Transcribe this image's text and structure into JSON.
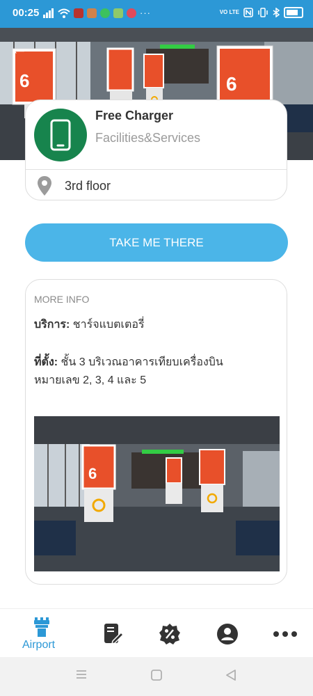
{
  "status_bar": {
    "time": "00:25",
    "left_icons": [
      "signal-icon",
      "wifi-icon",
      "app-icon",
      "app-icon",
      "whatsapp-icon",
      "app-icon",
      "app-icon"
    ],
    "more": "···",
    "right": {
      "volte": "VO LTE",
      "icons": [
        "nfc-icon",
        "vibrate-icon",
        "bluetooth-icon",
        "battery-icon"
      ]
    }
  },
  "hero": {
    "back_icon": "back-arrow-icon"
  },
  "facility": {
    "title": "Free Charger",
    "category": "Facilities&Services",
    "icon": "phone-icon",
    "location_icon": "map-pin-icon",
    "location": "3rd floor"
  },
  "actions": {
    "take_me_there": "TAKE ME THERE"
  },
  "more_info": {
    "label": "MORE INFO",
    "service_label": "บริการ:",
    "service_value": "ชาร์จแบตเตอรี่",
    "location_label": "ที่ตั้ง:",
    "location_value": "ชั้น 3 บริเวณอาคารเทียบเครื่องบิน",
    "location_value_2": "หมายเลข 2, 3, 4 และ 5"
  },
  "bottom_nav": {
    "items": [
      {
        "label": "Airport",
        "icon": "airport-tower-icon",
        "active": true
      },
      {
        "label": "",
        "icon": "notes-icon",
        "active": false
      },
      {
        "label": "",
        "icon": "discount-badge-icon",
        "active": false
      },
      {
        "label": "",
        "icon": "profile-icon",
        "active": false
      },
      {
        "label": "",
        "icon": "more-dots-icon",
        "active": false
      }
    ]
  },
  "system_nav": {
    "icons": [
      "recents-icon",
      "home-icon",
      "back-icon"
    ]
  },
  "colors": {
    "status_bar": "#2c98d6",
    "accent": "#4bb5e8",
    "facility_icon_bg": "#17844d",
    "active_nav": "#2c98d6",
    "inactive_nav": "#333333"
  }
}
